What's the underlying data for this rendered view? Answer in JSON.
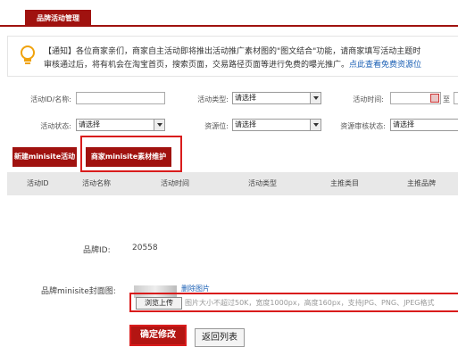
{
  "tab": {
    "label": "品牌活动管理"
  },
  "notice": {
    "line1": "【通知】各位商家亲们，商家自主活动即将推出活动推广素材图的\"图文结合\"功能，请商家填写活动主题时",
    "line2_text": "审核通过后，将有机会在淘宝首页，搜索页面，交易路径页面等进行免费的曝光推广。",
    "line2_link": "点此查看免费资源位"
  },
  "filters": {
    "activity_id_label": "活动ID/名称:",
    "activity_type_label": "活动类型:",
    "activity_type_value": "请选择",
    "activity_time_label": "活动时间:",
    "to_label": "至",
    "activity_status_label": "活动状态:",
    "activity_status_value": "请选择",
    "resource_label": "资源位:",
    "resource_value": "请选择",
    "resource_review_label": "资源审核状态:",
    "resource_review_value": "请选择"
  },
  "buttons": {
    "new_minisite": "新建minisite活动",
    "maintain_material": "商家minisite素材维护",
    "confirm": "确定修改",
    "back": "返回列表"
  },
  "table": {
    "columns": [
      "活动ID",
      "活动名称",
      "活动时间",
      "活动类型",
      "主推类目",
      "主推品牌"
    ]
  },
  "form": {
    "brand_id_label": "品牌ID:",
    "brand_id_value": "20558",
    "cover_label": "品牌minisite封面图:",
    "delete_link": "删除图片",
    "browse_button": "浏览上传",
    "upload_hint": "图片大小不超过50K，宽度1000px，高度160px，支持JPG、PNG、JPEG格式"
  },
  "colors": {
    "brand_red": "#a0120f",
    "highlight_red": "#d91c1c",
    "link_blue": "#1a5fb4"
  }
}
